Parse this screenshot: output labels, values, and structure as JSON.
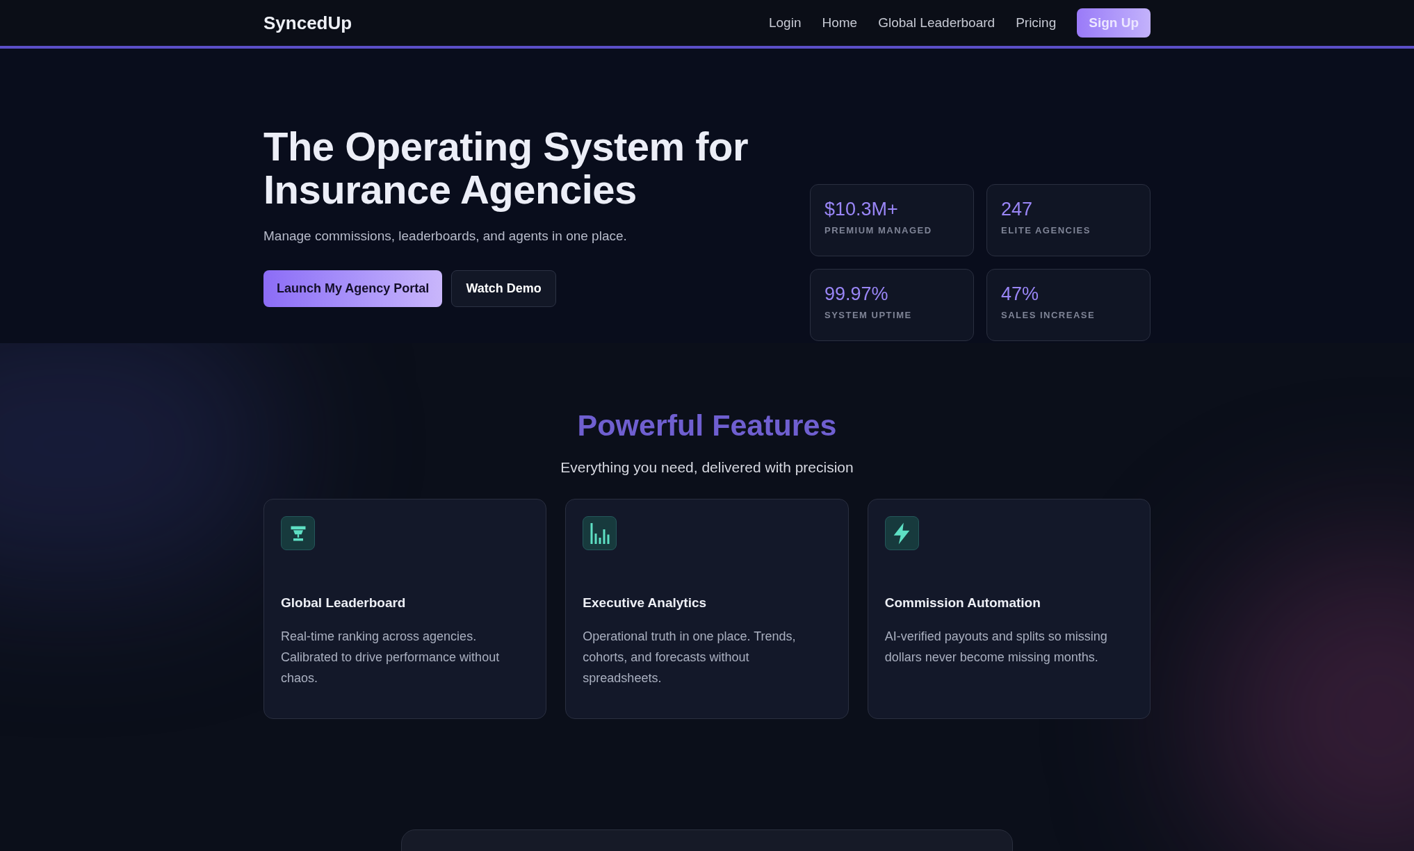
{
  "header": {
    "logo": "SyncedUp",
    "nav": [
      "Login",
      "Home",
      "Global Leaderboard",
      "Pricing"
    ],
    "signup": "Sign Up"
  },
  "hero": {
    "title": "The Operating System for Insurance Agencies",
    "subtitle": "Manage commissions, leaderboards, and agents in one place.",
    "primary_button": "Launch My Agency Portal",
    "secondary_button": "Watch Demo",
    "stats": [
      {
        "value": "$10.3M+",
        "label": "PREMIUM MANAGED"
      },
      {
        "value": "247",
        "label": "ELITE AGENCIES"
      },
      {
        "value": "99.97%",
        "label": "SYSTEM UPTIME"
      },
      {
        "value": "47%",
        "label": "SALES INCREASE"
      }
    ]
  },
  "features": {
    "title": "Powerful Features",
    "subtitle": "Everything you need, delivered with precision",
    "cards": [
      {
        "kind": "trophy",
        "title": "Global Leaderboard",
        "text": "Real-time ranking across agencies. Calibrated to drive performance without chaos."
      },
      {
        "kind": "chart",
        "title": "Executive Analytics",
        "text": "Operational truth in one place. Trends, cohorts, and forecasts without spreadsheets."
      },
      {
        "kind": "bolt",
        "title": "Commission Automation",
        "text": "AI-verified payouts and splits so missing dollars never become missing months."
      }
    ]
  }
}
